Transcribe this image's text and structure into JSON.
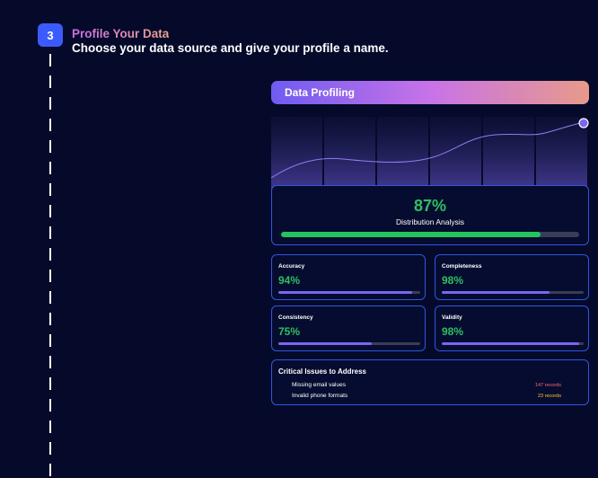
{
  "step": {
    "number": "3",
    "title": "Profile Your Data",
    "subtitle": "Choose your data source and give your profile a name."
  },
  "panel": {
    "header": "Data Profiling",
    "distribution": {
      "value": "87%",
      "label": "Distribution Analysis",
      "fraction": 0.87
    },
    "metrics": [
      {
        "name": "Accuracy",
        "value": "94%",
        "fraction": 0.94
      },
      {
        "name": "Completeness",
        "value": "98%",
        "fraction": 0.76
      },
      {
        "name": "Consistency",
        "value": "75%",
        "fraction": 0.66
      },
      {
        "name": "Validity",
        "value": "98%",
        "fraction": 0.97
      }
    ],
    "issues": {
      "title": "Critical Issues to Address",
      "items": [
        {
          "label": "Missing email values",
          "count": "147 records",
          "color": "#ff6b6b"
        },
        {
          "label": "Invalid phone formats",
          "count": "23 records",
          "color": "#ffc533"
        }
      ]
    }
  },
  "colors": {
    "background": "#050a2a",
    "step_badge": "#3b5bff",
    "card_border": "#2f56e0",
    "value_green": "#2fbf5f",
    "bar_purple": "#7b66f2"
  }
}
